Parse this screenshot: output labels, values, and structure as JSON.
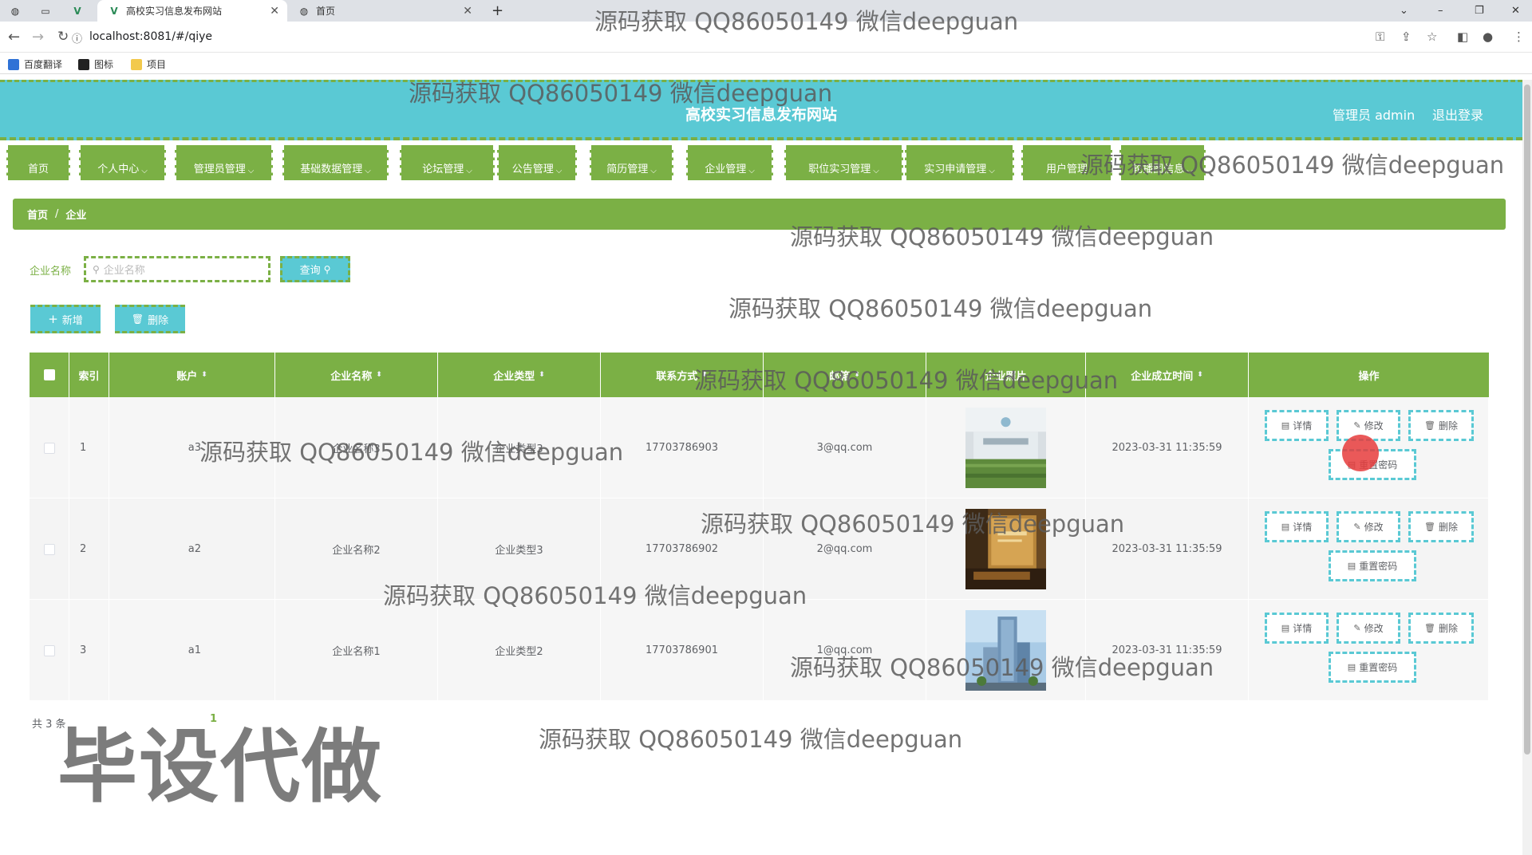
{
  "browser": {
    "tabs": [
      {
        "title": "高校实习信息发布网站",
        "active": true
      },
      {
        "title": "首页",
        "active": false
      }
    ],
    "url": "localhost:8081/#/qiye",
    "bookmarks": [
      "百度翻译",
      "图标",
      "项目"
    ]
  },
  "header": {
    "site_title": "高校实习信息发布网站",
    "admin_label": "管理员 admin",
    "logout_label": "退出登录",
    "colors": {
      "header_bg": "#5ac9d4",
      "accent_green": "#7bb045"
    }
  },
  "nav": {
    "items": [
      {
        "label": "首页",
        "has_menu": false
      },
      {
        "label": "个人中心",
        "has_menu": true
      },
      {
        "label": "管理员管理",
        "has_menu": true
      },
      {
        "label": "基础数据管理",
        "has_menu": true
      },
      {
        "label": "论坛管理",
        "has_menu": true
      },
      {
        "label": "公告管理",
        "has_menu": true
      },
      {
        "label": "简历管理",
        "has_menu": true
      },
      {
        "label": "企业管理",
        "has_menu": true
      },
      {
        "label": "职位实习管理",
        "has_menu": true
      },
      {
        "label": "实习申请管理",
        "has_menu": true
      },
      {
        "label": "用户管理",
        "has_menu": false
      },
      {
        "label": "轮播图信息",
        "has_menu": true
      }
    ]
  },
  "breadcrumb": {
    "home": "首页",
    "current": "企业"
  },
  "search": {
    "label": "企业名称",
    "placeholder": "企业名称",
    "query_label": "查询"
  },
  "actions": {
    "add_label": "新增",
    "delete_label": "删除"
  },
  "table": {
    "columns": [
      "索引",
      "账户",
      "企业名称",
      "企业类型",
      "联系方式",
      "邮箱",
      "企业照片",
      "企业成立时间",
      "操作"
    ],
    "rows": [
      {
        "index": "1",
        "account": "a3",
        "name": "企业名称3",
        "type": "企业类型3",
        "phone": "17703786903",
        "email": "3@qq.com",
        "photo": "lobby-wall",
        "time": "2023-03-31 11:35:59"
      },
      {
        "index": "2",
        "account": "a2",
        "name": "企业名称2",
        "type": "企业类型3",
        "phone": "17703786902",
        "email": "2@qq.com",
        "photo": "wood-reception",
        "time": "2023-03-31 11:35:59"
      },
      {
        "index": "3",
        "account": "a1",
        "name": "企业名称1",
        "type": "企业类型2",
        "phone": "17703786901",
        "email": "1@qq.com",
        "photo": "office-tower",
        "time": "2023-03-31 11:35:59"
      }
    ],
    "row_actions": {
      "detail": "详情",
      "edit": "修改",
      "delete": "删除",
      "reset_pwd": "重置密码"
    }
  },
  "pager": {
    "total_text": "共 3 条",
    "current_page": "1"
  },
  "watermarks": {
    "text": "源码获取 QQ86050149 微信deepguan",
    "big": "毕设代做"
  }
}
